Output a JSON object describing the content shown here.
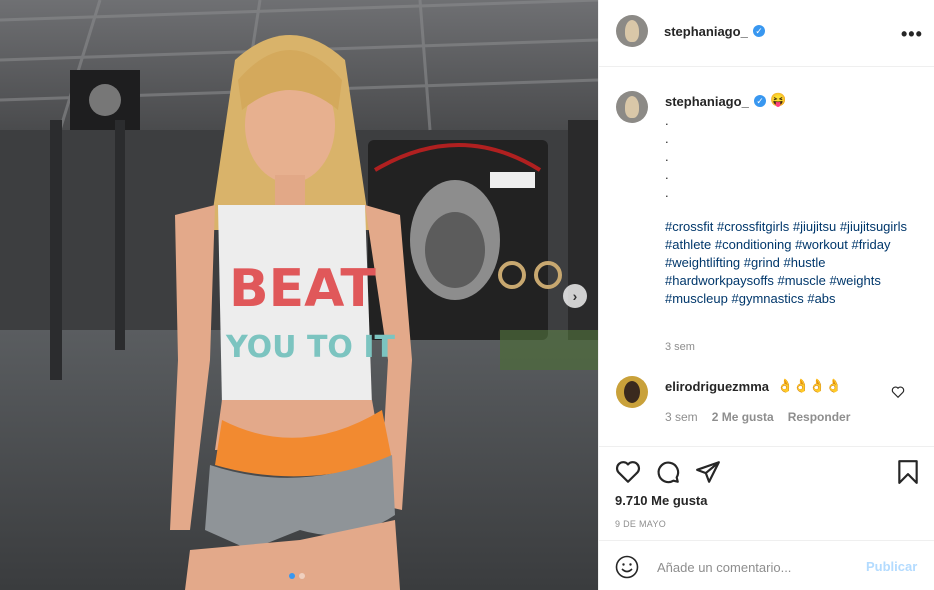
{
  "post": {
    "author": "stephaniago_",
    "caption_emoji": "😝",
    "caption_dots": [
      ".",
      ".",
      ".",
      ".",
      "."
    ],
    "hashtags": "#crossfit #crossfitgirls #jiujitsu #jiujitsugirls #athlete #conditioning #workout #friday #weightlifting #grind #hustle #hardworkpaysoffs #muscle #weights #muscleup #gymnastics #abs",
    "caption_time": "3 sem",
    "likes": "9.710 Me gusta",
    "date": "9 DE MAYO"
  },
  "photo": {
    "shirt_line1": "BEAT",
    "shirt_line2": "YOU TO IT"
  },
  "comment": {
    "user": "elirodriguezmma",
    "text": "👌👌👌👌",
    "time": "3 sem",
    "likes": "2 Me gusta",
    "reply": "Responder"
  },
  "composer": {
    "placeholder": "Añade un comentario...",
    "publish": "Publicar"
  },
  "carousel": {
    "current": 1,
    "total": 2
  },
  "icons": {
    "more": "more-options-icon",
    "like": "heart-icon",
    "comment": "comment-icon",
    "share": "share-icon",
    "save": "bookmark-icon",
    "emoji": "emoji-icon",
    "next": "chevron-right-icon",
    "verified": "verified-badge-icon"
  },
  "colors": {
    "link": "#00376b",
    "verified": "#3897f0",
    "publish_disabled": "#b3dbff",
    "meta": "#8e8e8e"
  }
}
